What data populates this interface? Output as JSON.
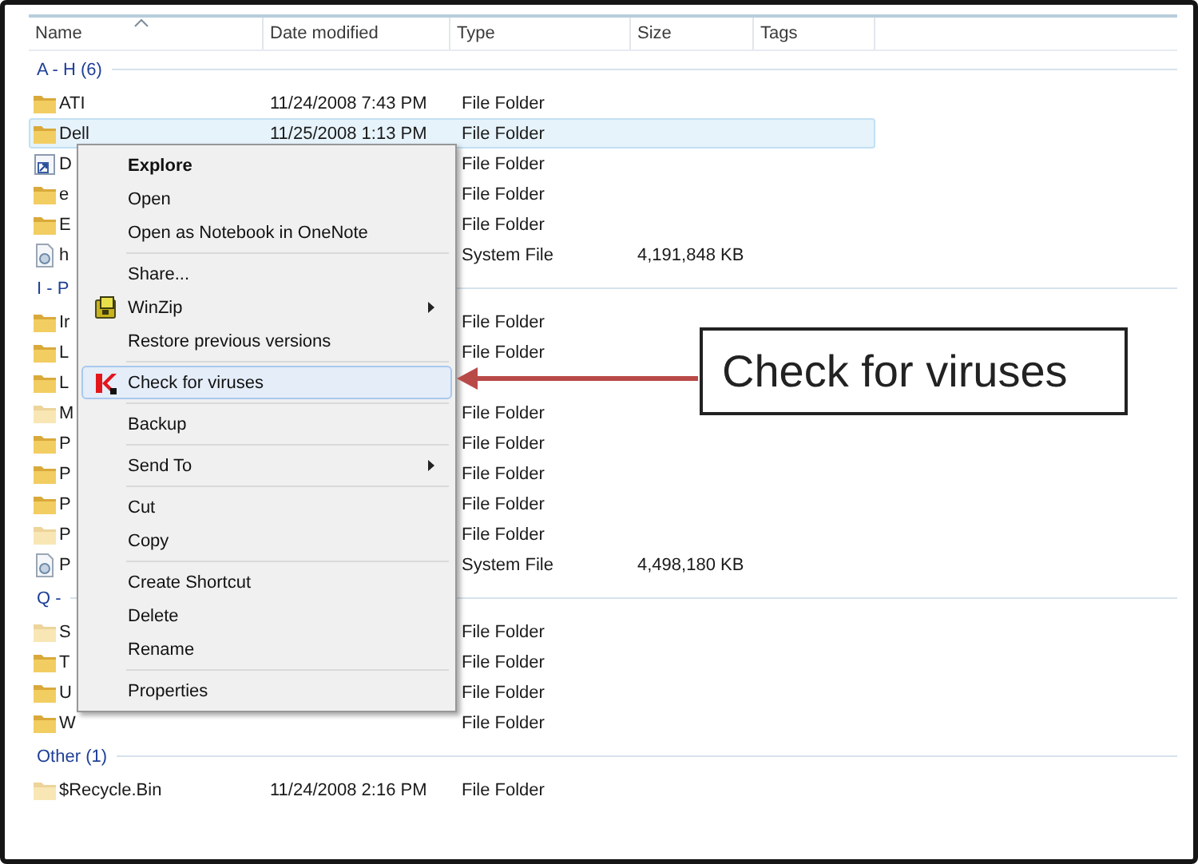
{
  "columns": [
    {
      "label": "Name",
      "sorted": true
    },
    {
      "label": "Date modified",
      "sorted": false
    },
    {
      "label": "Type",
      "sorted": false
    },
    {
      "label": "Size",
      "sorted": false
    },
    {
      "label": "Tags",
      "sorted": false
    }
  ],
  "groups": [
    {
      "label": "A - H (6)",
      "rows": [
        {
          "kind": "folder",
          "name": "ATI",
          "date": "11/24/2008 7:43 PM",
          "type": "File Folder",
          "selected": false
        },
        {
          "kind": "folder",
          "name": "Dell",
          "date": "11/25/2008 1:13 PM",
          "type": "File Folder",
          "selected": true
        },
        {
          "kind": "shortcut",
          "name": "D",
          "type": "File Folder",
          "selected": false
        },
        {
          "kind": "folder",
          "name": "e",
          "type": "File Folder",
          "selected": false
        },
        {
          "kind": "folder",
          "name": "E",
          "type": "File Folder",
          "selected": false
        },
        {
          "kind": "system",
          "name": "h",
          "type": "System File",
          "size": "4,191,848 KB",
          "selected": false
        }
      ]
    },
    {
      "label": "I - P",
      "rows": [
        {
          "kind": "folder",
          "name": "Ir",
          "type": "File Folder",
          "selected": false
        },
        {
          "kind": "folder",
          "name": "L",
          "type": "File Folder",
          "selected": false
        },
        {
          "kind": "folder",
          "name": "L",
          "selected": false
        },
        {
          "kind": "hidden",
          "name": "M",
          "type": "File Folder",
          "selected": false
        },
        {
          "kind": "folder",
          "name": "P",
          "type": "File Folder",
          "selected": false
        },
        {
          "kind": "folder",
          "name": "P",
          "type": "File Folder",
          "selected": false
        },
        {
          "kind": "folder",
          "name": "P",
          "type": "File Folder",
          "selected": false
        },
        {
          "kind": "hidden",
          "name": "P",
          "type": "File Folder",
          "selected": false
        },
        {
          "kind": "system",
          "name": "P",
          "type": "System File",
          "size": "4,498,180 KB",
          "selected": false
        }
      ]
    },
    {
      "label": "Q -",
      "rows": [
        {
          "kind": "hidden",
          "name": "S",
          "type": "File Folder",
          "selected": false
        },
        {
          "kind": "folder",
          "name": "T",
          "type": "File Folder",
          "selected": false
        },
        {
          "kind": "folder",
          "name": "U",
          "type": "File Folder",
          "selected": false
        },
        {
          "kind": "folder",
          "name": "W",
          "type": "File Folder",
          "selected": false
        }
      ]
    },
    {
      "label": "Other (1)",
      "rows": [
        {
          "kind": "hidden",
          "name": "$Recycle.Bin",
          "date": "11/24/2008 2:16 PM",
          "type": "File Folder",
          "selected": false
        }
      ]
    }
  ],
  "context_menu": {
    "items": [
      {
        "kind": "item",
        "label": "Explore",
        "default": true,
        "submenu": false,
        "selected": false
      },
      {
        "kind": "item",
        "label": "Open",
        "default": false,
        "submenu": false,
        "selected": false
      },
      {
        "kind": "item",
        "label": "Open as Notebook in OneNote",
        "default": false,
        "submenu": false,
        "selected": false
      },
      {
        "kind": "separator"
      },
      {
        "kind": "item",
        "label": "Share...",
        "default": false,
        "submenu": false,
        "selected": false
      },
      {
        "kind": "archive-item",
        "label": "WinZip",
        "default": false,
        "submenu": true,
        "selected": false
      },
      {
        "kind": "item",
        "label": "Restore previous versions",
        "default": false,
        "submenu": false,
        "selected": false
      },
      {
        "kind": "separator"
      },
      {
        "kind": "antivirus-item",
        "label": "Check for viruses",
        "default": false,
        "submenu": false,
        "selected": true
      },
      {
        "kind": "separator"
      },
      {
        "kind": "item",
        "label": "Backup",
        "default": false,
        "submenu": false,
        "selected": false
      },
      {
        "kind": "separator"
      },
      {
        "kind": "item",
        "label": "Send To",
        "default": false,
        "submenu": true,
        "selected": false
      },
      {
        "kind": "separator"
      },
      {
        "kind": "item",
        "label": "Cut",
        "default": false,
        "submenu": false,
        "selected": false
      },
      {
        "kind": "item",
        "label": "Copy",
        "default": false,
        "submenu": false,
        "selected": false
      },
      {
        "kind": "separator"
      },
      {
        "kind": "item",
        "label": "Create Shortcut",
        "default": false,
        "submenu": false,
        "selected": false
      },
      {
        "kind": "item",
        "label": "Delete",
        "default": false,
        "submenu": false,
        "selected": false
      },
      {
        "kind": "item",
        "label": "Rename",
        "default": false,
        "submenu": false,
        "selected": false
      },
      {
        "kind": "separator"
      },
      {
        "kind": "item",
        "label": "Properties",
        "default": false,
        "submenu": false,
        "selected": false
      }
    ]
  },
  "callout": {
    "text": "Check for viruses"
  }
}
